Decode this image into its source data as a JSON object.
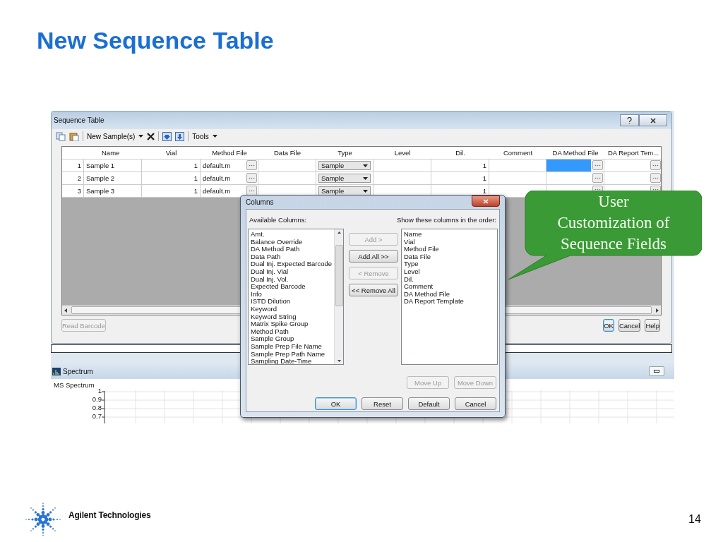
{
  "slide": {
    "title": "New Sequence Table",
    "logo_text": "Agilent Technologies",
    "page_number": "14"
  },
  "sequence_window": {
    "title": "Sequence Table",
    "toolbar": {
      "new_samples": "New Sample(s)",
      "tools": "Tools"
    },
    "columns": [
      "Name",
      "Vial",
      "Method File",
      "Data File",
      "Type",
      "Level",
      "Dil.",
      "Comment",
      "DA Method File",
      "DA Report Tem..."
    ],
    "rows": [
      {
        "number": "1",
        "name": "Sample 1",
        "vial": "1",
        "method_file": "default.m",
        "type": "Sample",
        "dil": "1",
        "da_method_file_selected": true
      },
      {
        "number": "2",
        "name": "Sample 2",
        "vial": "1",
        "method_file": "default.m",
        "type": "Sample",
        "dil": "1",
        "da_method_file_selected": false
      },
      {
        "number": "3",
        "name": "Sample 3",
        "vial": "1",
        "method_file": "default.m",
        "type": "Sample",
        "dil": "1",
        "da_method_file_selected": false
      }
    ],
    "read_barcode": {
      "label": "Read Barcode",
      "disabled": true
    },
    "buttons": [
      {
        "label": "OK",
        "default": true
      },
      {
        "label": "Cancel",
        "default": false
      },
      {
        "label": "Help",
        "default": false
      }
    ]
  },
  "spectrum_window": {
    "title": "Spectrum",
    "chart_title": "MS Spectrum",
    "y_ticks": [
      "1",
      "0.9",
      "0.8",
      "0.7"
    ]
  },
  "columns_dialog": {
    "title": "Columns",
    "available_label": "Available Columns:",
    "shown_label": "Show these columns in the order:",
    "available": [
      "Amt.",
      "Balance Override",
      "DA Method Path",
      "Data Path",
      "Dual Inj. Expected Barcode",
      "Dual Inj. Vial",
      "Dual Inj. Vol.",
      "Expected Barcode",
      "Info",
      "ISTD Dilution",
      "Keyword",
      "Keyword String",
      "Matrix Spike Group",
      "Method Path",
      "Sample Group",
      "Sample Prep File Name",
      "Sample Prep Path Name",
      "Sampling Date-Time"
    ],
    "shown": [
      "Name",
      "Vial",
      "Method File",
      "Data File",
      "Type",
      "Level",
      "Dil.",
      "Comment",
      "DA Method File",
      "DA Report Template"
    ],
    "move_buttons": [
      {
        "label": "Add >",
        "disabled": true
      },
      {
        "label": "Add All >>",
        "disabled": false
      },
      {
        "label": "< Remove",
        "disabled": true
      },
      {
        "label": "<< Remove All",
        "disabled": false
      }
    ],
    "order_buttons": [
      {
        "label": "Move Up",
        "disabled": true
      },
      {
        "label": "Move Down",
        "disabled": true
      }
    ],
    "footer_buttons": [
      {
        "label": "OK",
        "default": true
      },
      {
        "label": "Reset",
        "default": false
      },
      {
        "label": "Default",
        "default": false
      },
      {
        "label": "Cancel",
        "default": false
      }
    ]
  },
  "callout": {
    "text": "User Customization of Sequence Fields"
  }
}
